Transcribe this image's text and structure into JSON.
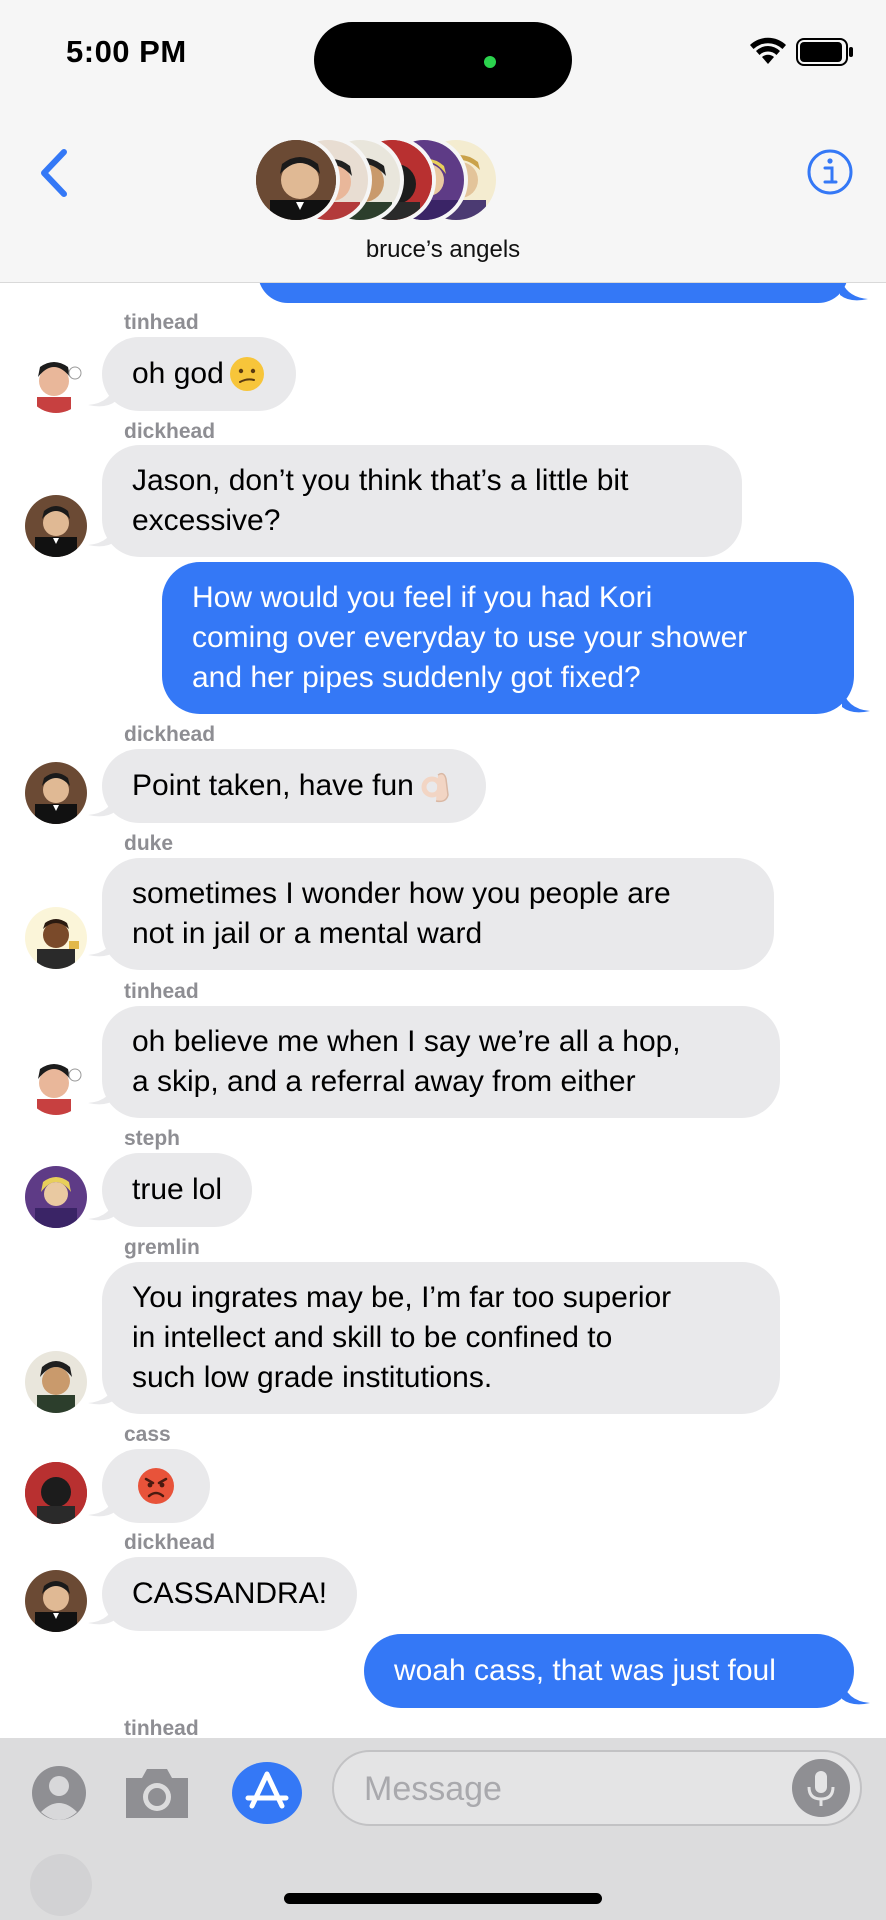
{
  "status_bar": {
    "time": "5:00 PM"
  },
  "header": {
    "group_name": "bruce’s angels",
    "back_icon": "chevron-left-icon",
    "info_icon": "info-icon"
  },
  "messages": [
    {
      "sender": "tinhead",
      "text": "oh god",
      "emoji": "confused-face"
    },
    {
      "sender": "dickhead",
      "text": "Jason, don’t you think that’s a little bit\nexcessive?"
    },
    {
      "sender": "me",
      "text": "How would you feel if you had Kori\ncoming over everyday to use your shower\nand her pipes suddenly got fixed?"
    },
    {
      "sender": "dickhead",
      "text": "Point taken, have fun",
      "emoji": "ok-hand"
    },
    {
      "sender": "duke",
      "text": "sometimes I wonder how you people are\nnot in jail or a mental ward"
    },
    {
      "sender": "tinhead",
      "text": "oh believe me when I say we’re all a hop,\na skip, and a referral away from either"
    },
    {
      "sender": "steph",
      "text": "true lol"
    },
    {
      "sender": "gremlin",
      "text": "You ingrates may be, I’m far too superior\nin intellect and skill to be confined to\nsuch low grade institutions."
    },
    {
      "sender": "cass",
      "text": "",
      "emoji": "angry-face"
    },
    {
      "sender": "dickhead",
      "text": "CASSANDRA!"
    },
    {
      "sender": "me",
      "text": "woah cass, that was just foul"
    },
    {
      "sender": "tinhead",
      "text": ""
    }
  ],
  "input_bar": {
    "placeholder": "Message",
    "icons": [
      "contact-icon",
      "camera-icon",
      "app-store-icon",
      "mic-icon"
    ]
  },
  "colors": {
    "bubble_out": "#3478f6",
    "bubble_in": "#e9e9eb",
    "accent": "#3478f6"
  }
}
